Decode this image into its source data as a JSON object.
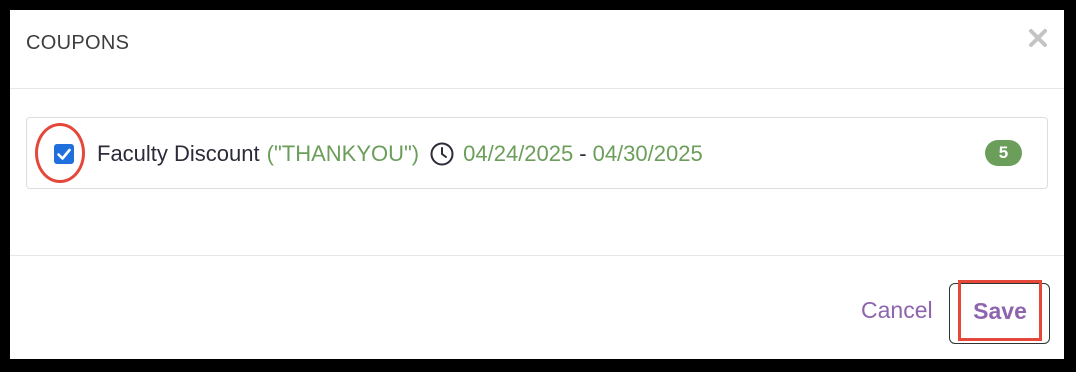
{
  "modal": {
    "title": "COUPONS",
    "close_icon": "close-icon"
  },
  "coupons": [
    {
      "checked": true,
      "name": "Faculty Discount",
      "code": "(\"THANKYOU\")",
      "icon": "clock-icon",
      "start_date": "04/24/2025",
      "separator": "-",
      "end_date": "04/30/2025",
      "count": "5"
    }
  ],
  "footer": {
    "cancel_label": "Cancel",
    "save_label": "Save"
  },
  "colors": {
    "accent_green": "#6b9e5a",
    "button_purple": "#8e64ad",
    "checkbox_blue": "#1f6fdc",
    "highlight_red": "#e5473a"
  }
}
